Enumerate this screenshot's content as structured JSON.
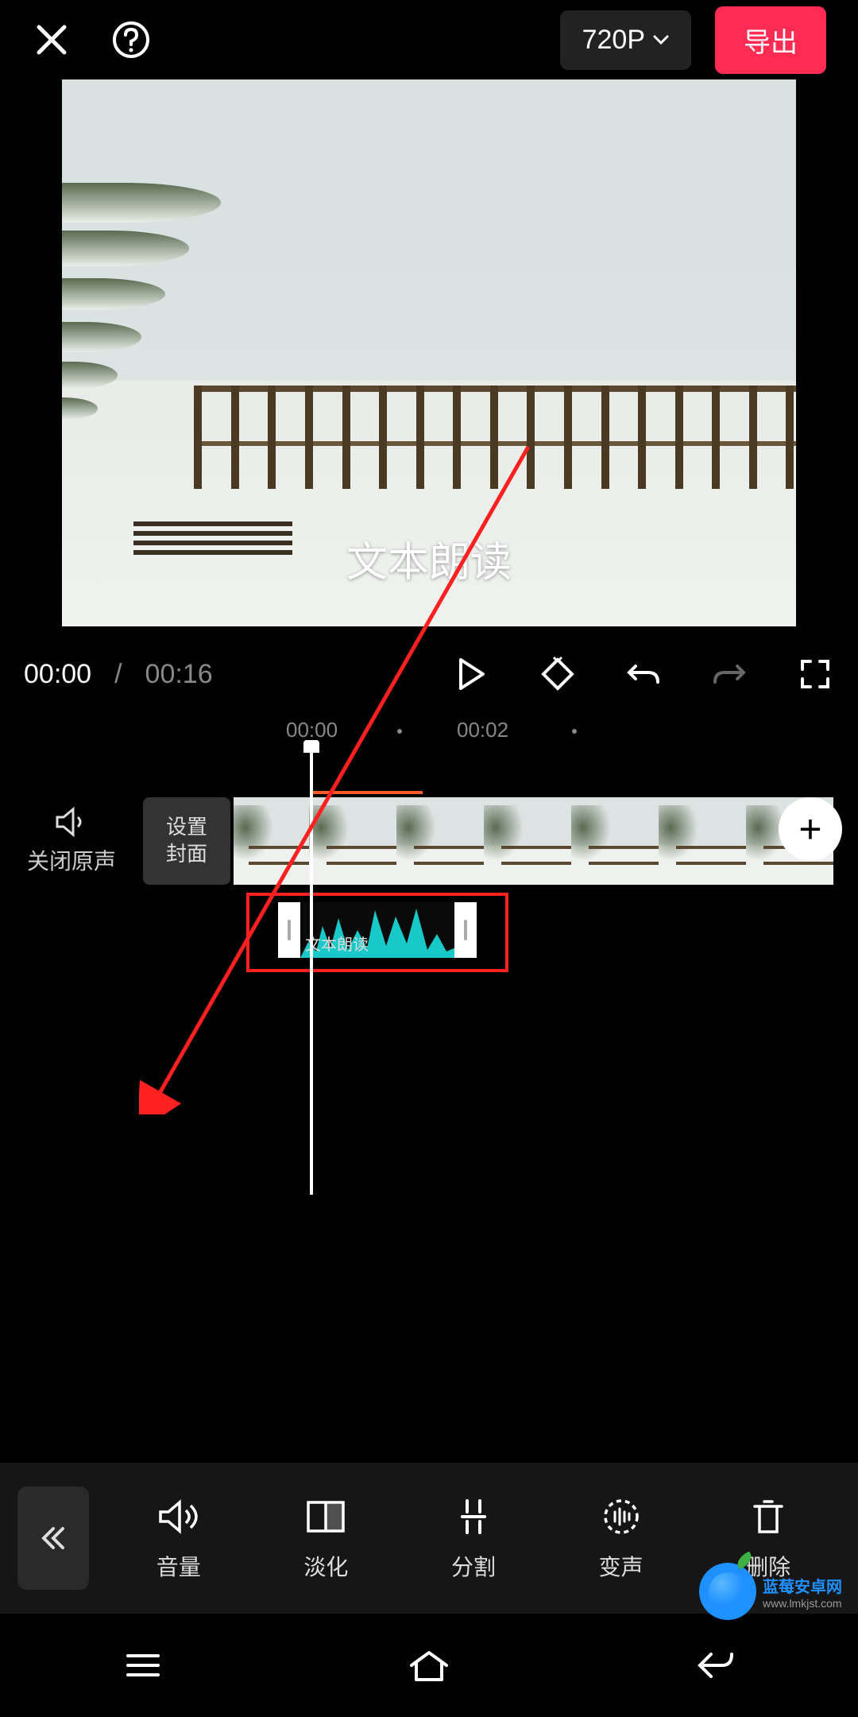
{
  "header": {
    "resolution_label": "720P",
    "export_label": "导出"
  },
  "preview": {
    "overlay_text": "文本朗读"
  },
  "playback": {
    "current_time": "00:00",
    "separator": "/",
    "total_time": "00:16"
  },
  "timeline": {
    "marks": [
      "00:00",
      "00:02"
    ],
    "mute_label": "关闭原声",
    "cover_line1": "设置",
    "cover_line2": "封面",
    "audio_clip_label": "文本朗读",
    "add_label": "+"
  },
  "toolbar": {
    "items": [
      {
        "label": "音量",
        "icon": "volume-icon"
      },
      {
        "label": "淡化",
        "icon": "fade-icon"
      },
      {
        "label": "分割",
        "icon": "split-icon"
      },
      {
        "label": "变声",
        "icon": "voice-change-icon"
      },
      {
        "label": "删除",
        "icon": "delete-icon"
      }
    ]
  },
  "watermark": {
    "line1": "蓝莓安卓网",
    "line2": "www.lmkjst.com"
  }
}
